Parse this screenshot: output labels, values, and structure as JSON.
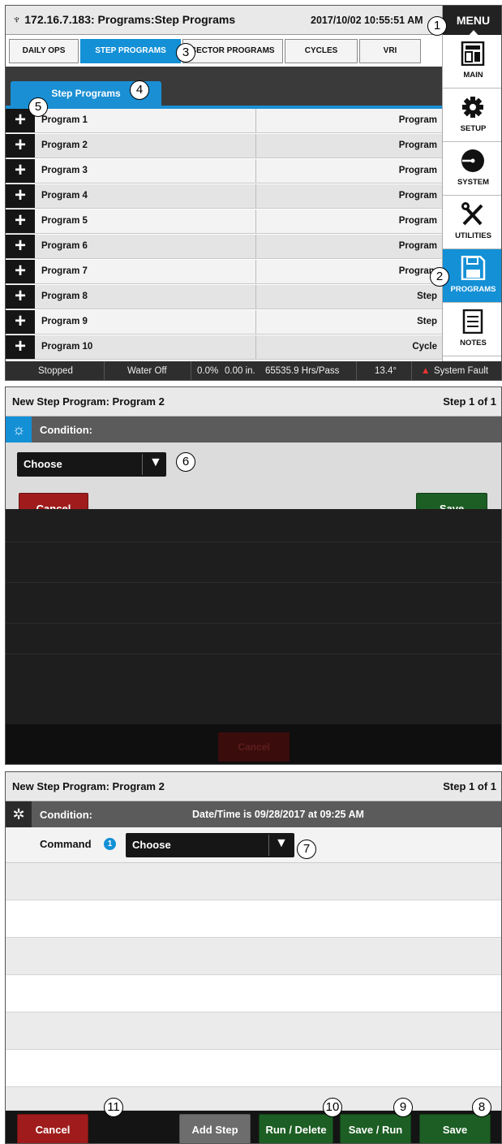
{
  "panel1": {
    "title": "172.16.7.183: Programs:Step Programs",
    "clock": "2017/10/02 10:55:51 AM",
    "tabs": [
      {
        "label": "DAILY OPS",
        "active": false
      },
      {
        "label": "STEP PROGRAMS",
        "active": true
      },
      {
        "label": "SECTOR PROGRAMS",
        "active": false
      },
      {
        "label": "CYCLES",
        "active": false
      },
      {
        "label": "VRI",
        "active": false
      }
    ],
    "subtab": "Step Programs",
    "programs": [
      {
        "name": "Program 1",
        "type": "Program"
      },
      {
        "name": "Program 2",
        "type": "Program"
      },
      {
        "name": "Program 3",
        "type": "Program"
      },
      {
        "name": "Program 4",
        "type": "Program"
      },
      {
        "name": "Program 5",
        "type": "Program"
      },
      {
        "name": "Program 6",
        "type": "Program"
      },
      {
        "name": "Program 7",
        "type": "Program"
      },
      {
        "name": "Program 8",
        "type": "Step"
      },
      {
        "name": "Program 9",
        "type": "Step"
      },
      {
        "name": "Program 10",
        "type": "Cycle"
      }
    ],
    "status": {
      "state": "Stopped",
      "water": "Water Off",
      "percent": "0.0%",
      "depth": "0.00 in.",
      "rate": "65535.9 Hrs/Pass",
      "angle": "13.4°",
      "fault": "System Fault"
    },
    "menu": {
      "header": "MENU",
      "items": [
        {
          "label": "MAIN",
          "icon": "main-panel-icon",
          "active": false
        },
        {
          "label": "SETUP",
          "icon": "gear-icon",
          "active": false
        },
        {
          "label": "SYSTEM",
          "icon": "system-dial-icon",
          "active": false
        },
        {
          "label": "UTILITIES",
          "icon": "tools-icon",
          "active": false
        },
        {
          "label": "PROGRAMS",
          "icon": "floppy-disk-icon",
          "active": true
        },
        {
          "label": "NOTES",
          "icon": "notes-icon",
          "active": false
        }
      ]
    }
  },
  "panel2": {
    "title": "New Step Program:  Program 2",
    "step": "Step 1 of 1",
    "condition_label": "Condition:",
    "dropdown_value": "Choose",
    "cancel": "Cancel",
    "save": "Save",
    "ghost_cancel": "Cancel"
  },
  "panel3": {
    "title": "New Step Program:  Program 2",
    "step": "Step 1 of 1",
    "condition_label": "Condition:",
    "condition_value": "Date/Time is 09/28/2017 at 09:25 AM",
    "command_label": "Command",
    "info_badge": "1",
    "dropdown_value": "Choose",
    "buttons": {
      "cancel": "Cancel",
      "add_step": "Add Step",
      "run_delete": "Run / Delete",
      "save_run": "Save / Run",
      "save": "Save"
    }
  },
  "callouts": [
    "1",
    "2",
    "3",
    "4",
    "5",
    "6",
    "7",
    "8",
    "9",
    "10",
    "11"
  ],
  "colors": {
    "accent_blue": "#1390d6",
    "cancel_red": "#a01c1c",
    "save_green": "#1c5e23",
    "dark": "#1e1e1e"
  }
}
